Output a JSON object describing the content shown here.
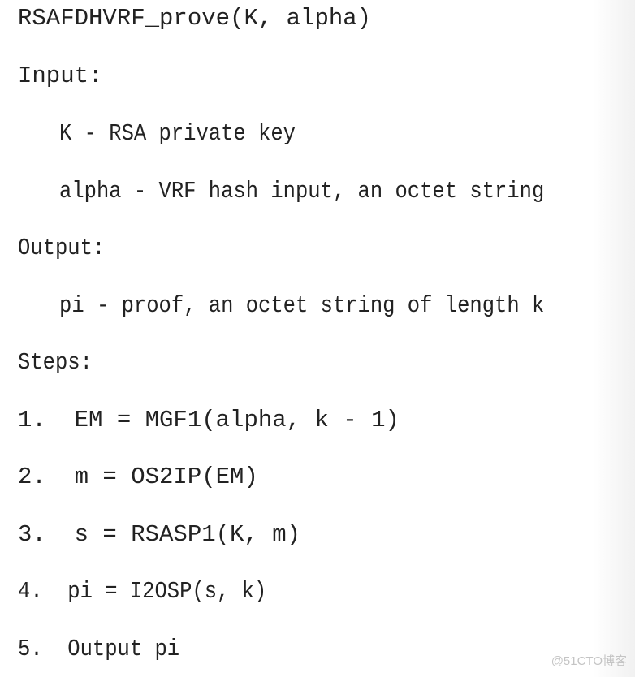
{
  "document": {
    "title": "RSAFDHVRF_prove(K, alpha)",
    "input_heading": "Input:",
    "inputs": [
      "K - RSA private key",
      "alpha - VRF hash input, an octet string"
    ],
    "output_heading": "Output:",
    "outputs": [
      "pi - proof, an octet string of length k"
    ],
    "steps_heading": "Steps:",
    "steps": [
      "1.  EM = MGF1(alpha, k - 1)",
      "2.  m = OS2IP(EM)",
      "3.  s = RSASP1(K, m)",
      "4.  pi = I2OSP(s, k)",
      "5.  Output pi"
    ]
  },
  "watermark": "@51CTO博客"
}
